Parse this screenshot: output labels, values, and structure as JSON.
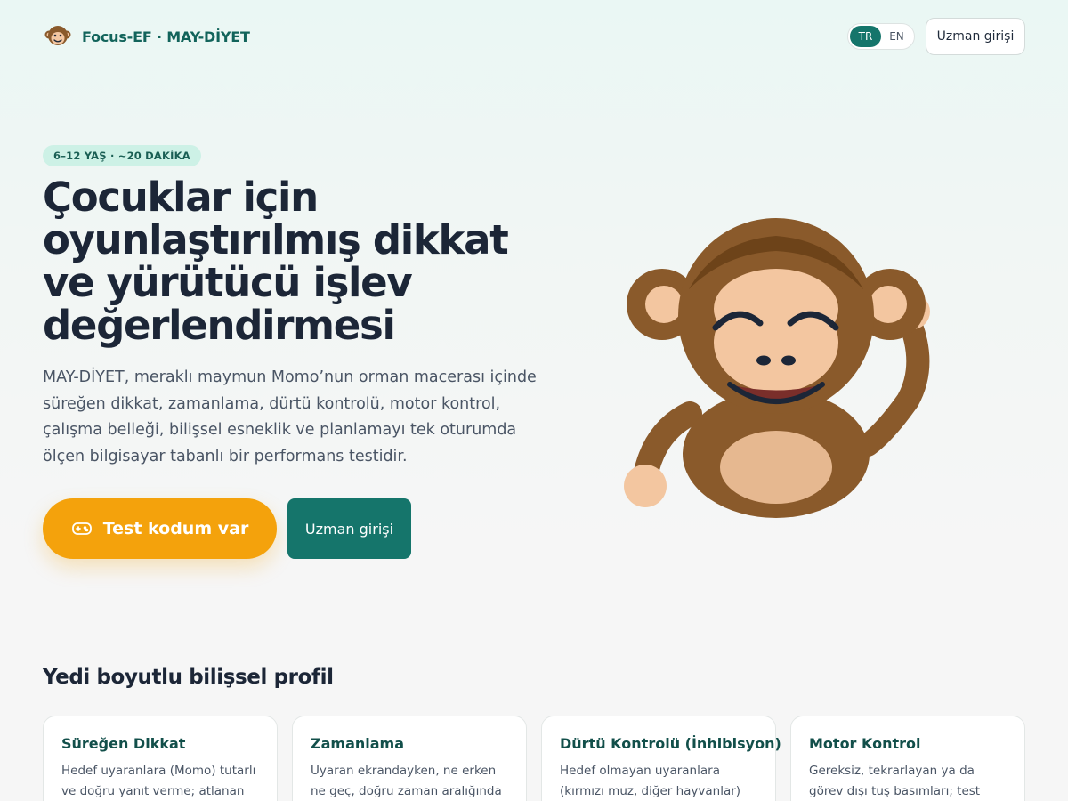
{
  "header": {
    "brand": "Focus-EF · MAY-DİYET",
    "logo_icon": "monkey-logo-icon",
    "languages": [
      {
        "code": "TR",
        "active": true
      },
      {
        "code": "EN",
        "active": false
      }
    ],
    "login_label": "Uzman girişi"
  },
  "hero": {
    "badge": "6–12 YAŞ · ~20 DAKİKA",
    "title": "Çocuklar için oyunlaştırılmış dikkat ve yürütücü işlev değerlendirmesi",
    "description": "MAY-DİYET, meraklı maymun Momo’nun orman macerası içinde süreğen dikkat, zamanlama, dürtü kontrolü, motor kontrol, çalışma belleği, bilişsel esneklik ve planlamayı tek oturumda ölçen bilgisayar tabanlı bir performans testidir.",
    "primary_button": "Test kodum var",
    "primary_icon": "gamepad-icon",
    "secondary_button": "Uzman girişi",
    "illustration": "monkey-mascot"
  },
  "section": {
    "title": "Yedi boyutlu bilişsel profil",
    "cards": [
      {
        "title": "Süreğen Dikkat",
        "text": "Hedef uyaranlara (Momo) tutarlı ve doğru yanıt verme; atlanan hedefler"
      },
      {
        "title": "Zamanlama",
        "text": "Uyaran ekrandayken, ne erken ne geç, doğru zaman aralığında yanıt"
      },
      {
        "title": "Dürtü Kontrolü (İnhibisyon)",
        "text": "Hedef olmayan uyaranlara (kırmızı muz, diğer hayvanlar) yanıt"
      },
      {
        "title": "Motor Kontrol",
        "text": "Gereksiz, tekrarlayan ya da görev dışı tuş basımları; test sırasında"
      }
    ]
  },
  "colors": {
    "brand_teal": "#15756b",
    "accent_orange": "#f4a20c",
    "badge_bg": "#cdf1e6"
  }
}
